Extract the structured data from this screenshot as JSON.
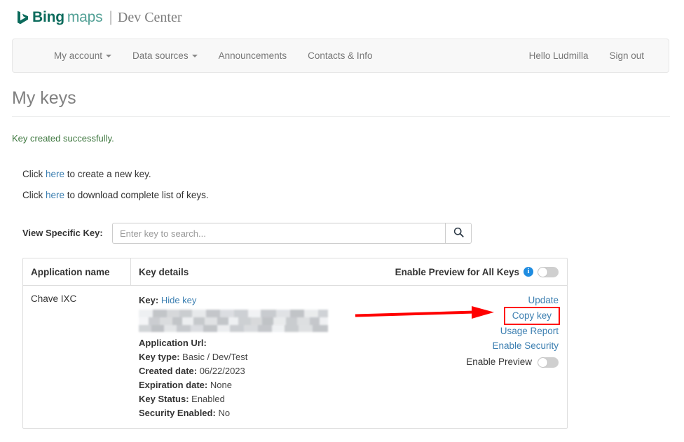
{
  "brand": {
    "logo_icon": "bing-logo-icon",
    "bing": "Bing",
    "maps": "maps",
    "separator": "|",
    "dev_center": "Dev Center"
  },
  "nav": {
    "left_items": [
      {
        "label": "My account",
        "has_caret": true
      },
      {
        "label": "Data sources",
        "has_caret": true
      },
      {
        "label": "Announcements",
        "has_caret": false
      },
      {
        "label": "Contacts & Info",
        "has_caret": false
      }
    ],
    "right_items": [
      {
        "label": "Hello Ludmilla"
      },
      {
        "label": "Sign out"
      }
    ]
  },
  "page": {
    "title": "My keys",
    "status_message": "Key created successfully.",
    "status_color": "#3c763d"
  },
  "instructions": [
    {
      "prefix": "Click ",
      "link": "here",
      "suffix": " to create a new key."
    },
    {
      "prefix": "Click ",
      "link": "here",
      "suffix": " to download complete list of keys."
    }
  ],
  "search": {
    "label": "View Specific Key:",
    "value": "",
    "placeholder": "Enter key to search...",
    "button_icon": "search-icon"
  },
  "table": {
    "headers": {
      "application_name": "Application name",
      "key_details": "Key details",
      "enable_preview_all": "Enable Preview for All Keys",
      "info_icon": "info-icon",
      "info_glyph": "i",
      "all_keys_toggle_state": "off"
    },
    "row": {
      "application_name": "Chave IXC",
      "key_label": "Key:",
      "key_toggle_link": "Hide key",
      "key_value_redacted": "",
      "details": [
        {
          "label": "Application Url:",
          "value": ""
        },
        {
          "label": "Key type:",
          "value": "Basic / Dev/Test"
        },
        {
          "label": "Created date:",
          "value": "06/22/2023"
        },
        {
          "label": "Expiration date:",
          "value": "None"
        },
        {
          "label": "Key Status:",
          "value": "Enabled"
        },
        {
          "label": "Security Enabled:",
          "value": "No"
        }
      ],
      "actions": [
        {
          "label": "Update",
          "highlighted": false
        },
        {
          "label": "Copy key",
          "highlighted": true
        },
        {
          "label": "Usage Report",
          "highlighted": false
        },
        {
          "label": "Enable Security",
          "highlighted": false
        }
      ],
      "enable_preview_label": "Enable Preview",
      "enable_preview_toggle_state": "off"
    }
  },
  "annotation": {
    "arrow_color": "#ff0000",
    "highlight_box_color": "#ff0000",
    "points_to": "Copy key"
  },
  "colors": {
    "link": "#3c7fb1",
    "brand_dark": "#0c6b5c",
    "brand_light": "#53a196",
    "success": "#3c763d",
    "info_badge": "#1f8ce0"
  }
}
